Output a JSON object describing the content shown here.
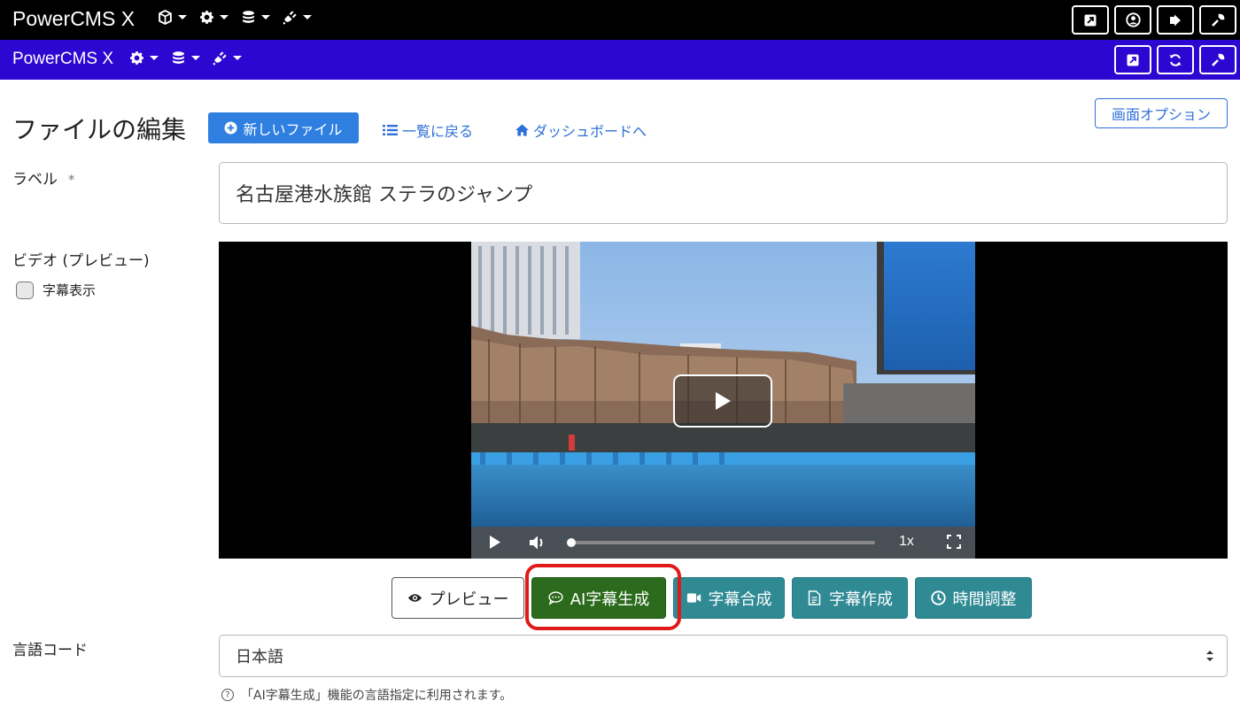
{
  "topbar": {
    "brand": "PowerCMS X"
  },
  "subbar": {
    "brand": "PowerCMS X"
  },
  "page": {
    "title": "ファイルの編集",
    "new_file_button": "新しいファイル",
    "back_to_list": "一覧に戻る",
    "dashboard_link": "ダッシュボードへ",
    "screen_options": "画面オプション"
  },
  "form": {
    "label_field": {
      "label": "ラベル",
      "required_mark": "*",
      "value": "名古屋港水族館 ステラのジャンプ"
    },
    "video": {
      "label": "ビデオ (プレビュー)",
      "subtitle_checkbox": "字幕表示",
      "subtitle_checked": false,
      "speed": "1x",
      "progress": 0.0
    },
    "actions": {
      "preview": "プレビュー",
      "ai_subtitle": "AI字幕生成",
      "merge_subtitle": "字幕合成",
      "create_subtitle": "字幕作成",
      "time_adjust": "時間調整"
    },
    "language": {
      "label": "言語コード",
      "value": "日本語",
      "help": "「AI字幕生成」機能の言語指定に利用されます。"
    }
  },
  "colors": {
    "topbar": "#000000",
    "subbar": "#2c06d1",
    "primary": "#2f7fe1",
    "ai_button": "#2c6b1d",
    "teal_button": "#2f8a94",
    "highlight": "#e01a1a"
  }
}
